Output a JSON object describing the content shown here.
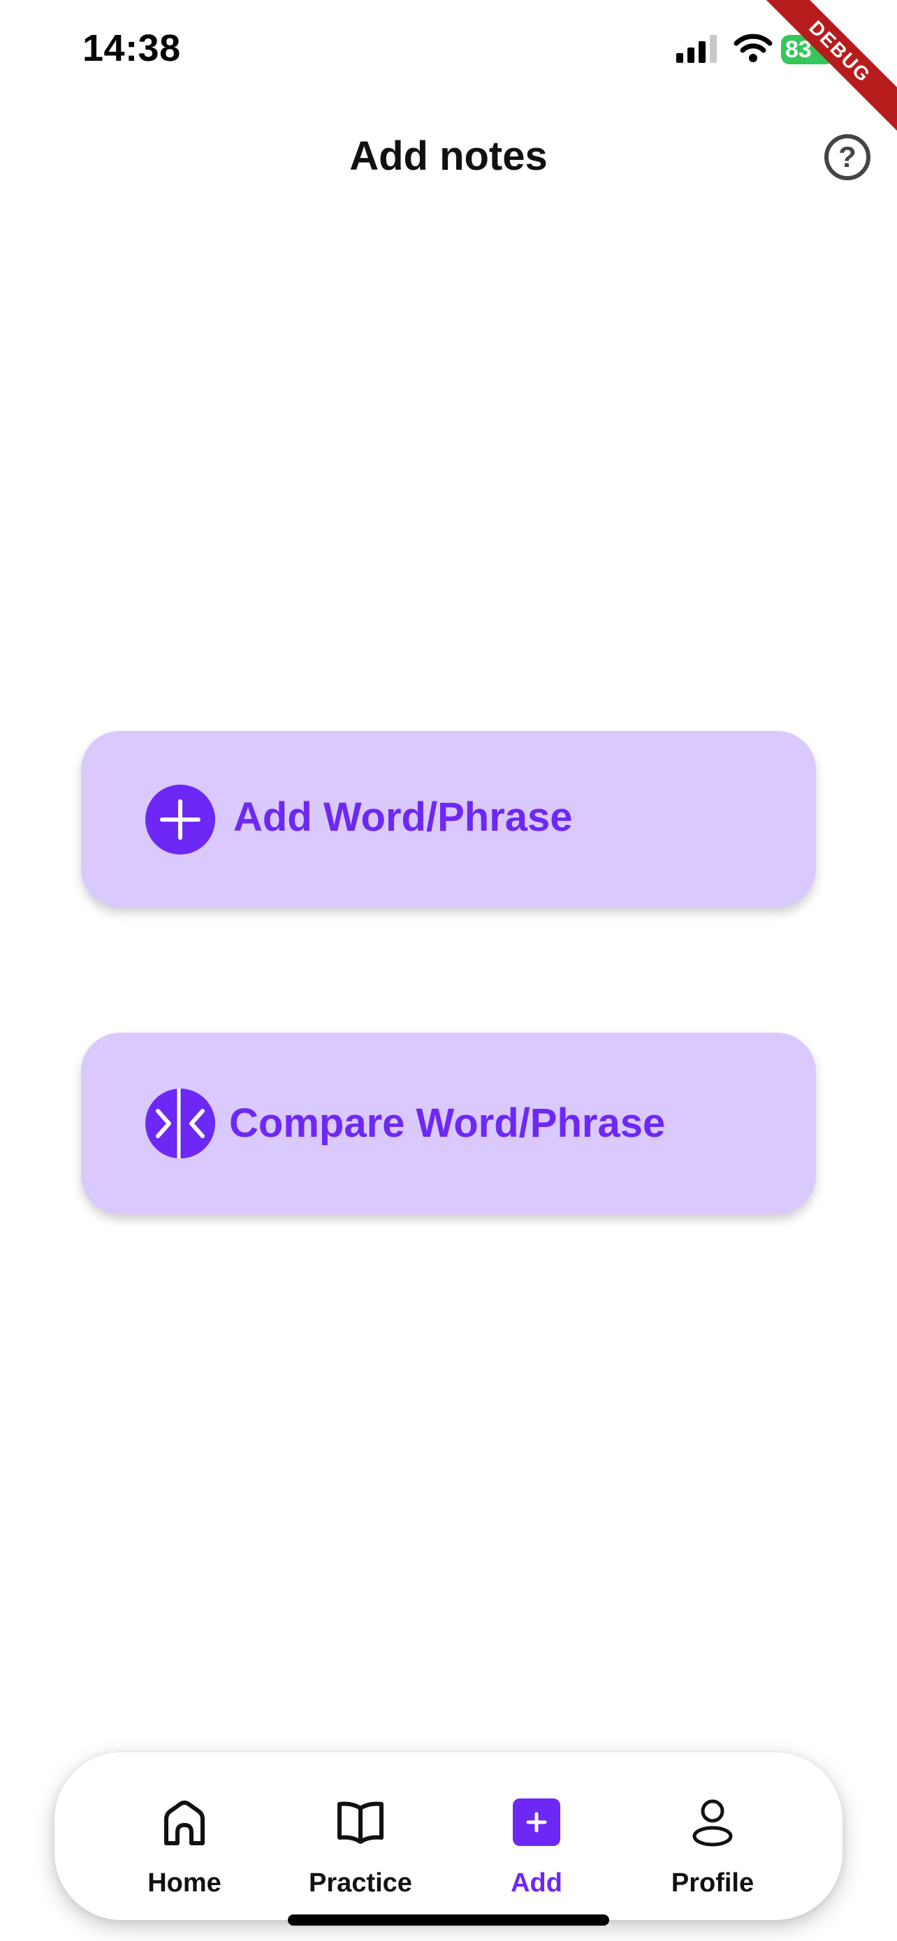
{
  "status_bar": {
    "time": "14:38",
    "battery": "83",
    "battery_color": "#34c759",
    "icons": [
      "cellular-signal-icon",
      "wifi-icon",
      "battery-charging-icon"
    ]
  },
  "debug_banner": "DEBUG",
  "header": {
    "title": "Add notes",
    "help_icon": "question-circle-icon",
    "help_glyph": "?"
  },
  "actions": {
    "add": {
      "label": "Add Word/Phrase",
      "icon": "plus-circle-icon"
    },
    "compare": {
      "label": "Compare Word/Phrase",
      "icon": "compare-arrows-icon"
    }
  },
  "nav": {
    "items": [
      {
        "label": "Home",
        "icon": "home-icon",
        "active": false
      },
      {
        "label": "Practice",
        "icon": "book-icon",
        "active": false
      },
      {
        "label": "Add",
        "icon": "add-square-icon",
        "active": true
      },
      {
        "label": "Profile",
        "icon": "person-icon",
        "active": false
      }
    ]
  },
  "colors": {
    "accent": "#6d28f5",
    "button_background": "#dac9fd",
    "debug_ribbon": "#b71c1c"
  }
}
